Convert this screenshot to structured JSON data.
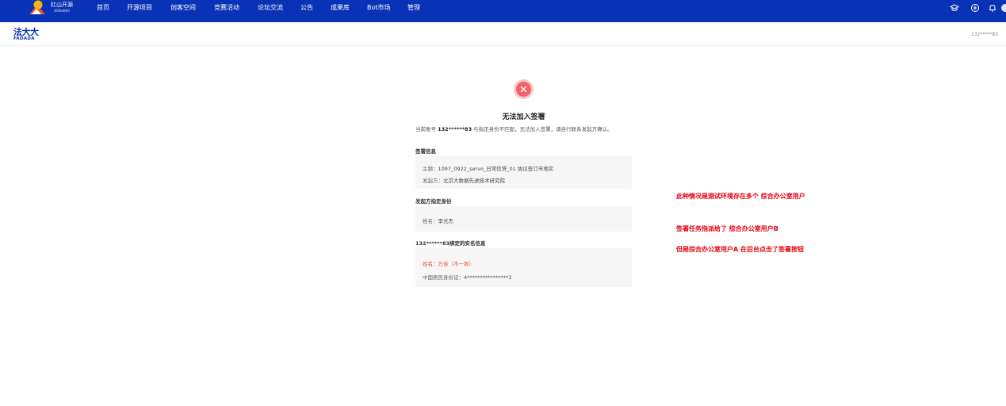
{
  "nav": {
    "logo_title": "红山开源",
    "logo_subtitle": "OSRedHill",
    "items": [
      {
        "label": "首页"
      },
      {
        "label": "开源项目"
      },
      {
        "label": "创客空间"
      },
      {
        "label": "竞赛活动"
      },
      {
        "label": "论坛交流"
      },
      {
        "label": "公告"
      },
      {
        "label": "成果库"
      },
      {
        "label": "Bot市场"
      },
      {
        "label": "管理"
      }
    ],
    "icons": [
      "graduation-cap-icon",
      "plus-circle-icon",
      "bell-icon",
      "user-icon"
    ]
  },
  "header": {
    "brand_cn": "法大大",
    "brand_en": "FADADA",
    "phone": "132*****83"
  },
  "result": {
    "icon": "close-icon",
    "title": "无法加入签署",
    "desc_prefix": "当前账号",
    "desc_account": "132******83",
    "desc_suffix": "与指定身份不匹配，无法加入签署，请自行联系发起方确认。"
  },
  "sign_info": {
    "label": "签署信息",
    "topic_key": "主题：",
    "topic_val": "1097_0922_servo_日常信贷_01 协议签订市地实",
    "initiator_key": "发起方：",
    "initiator_val": "北京大数据先进技术研究院"
  },
  "designated": {
    "label": "发起方指定身份",
    "name_key": "姓名：",
    "name_val": "李光杰"
  },
  "bound": {
    "label": "132******83绑定的实名信息",
    "name_key": "姓名：",
    "name_val": "万佳（不一致）",
    "id_key": "中国居民身份证：",
    "id_val": "4****************3"
  },
  "notes": [
    "此种情况是测试环境存在多个 综合办公室用户",
    "签署任务指派给了  综合办公室用户B",
    "但是综合办公室用户A 在后台点击了签署按钮"
  ],
  "colors": {
    "nav_bg": "#0a32b6",
    "error_red": "#f0636b",
    "note_red": "#e60012",
    "card_bg": "#f6f6f6"
  }
}
